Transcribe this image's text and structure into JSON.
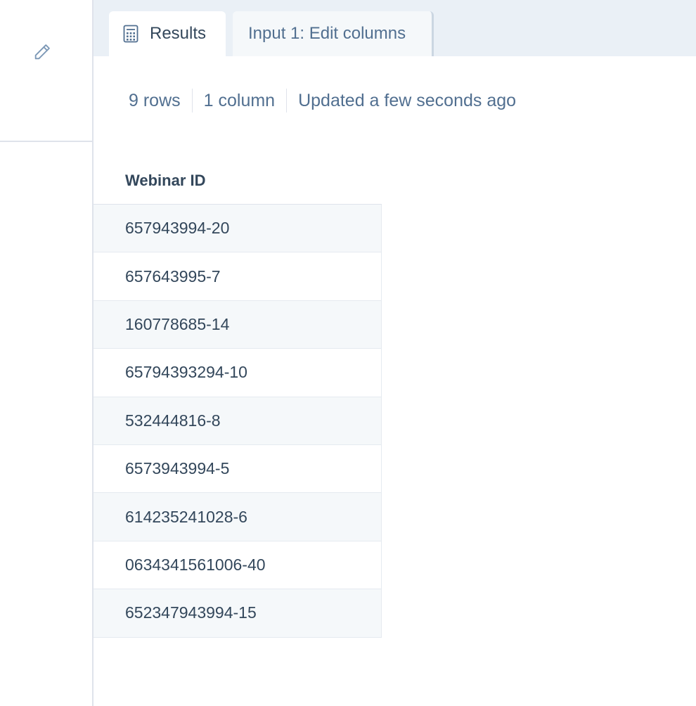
{
  "sidebar": {
    "edit_icon": "pencil-icon"
  },
  "tabs": [
    {
      "label": "Results",
      "icon": "calculator-icon",
      "active": true
    },
    {
      "label": "Input 1: Edit columns",
      "active": false
    }
  ],
  "meta": {
    "rows": "9 rows",
    "columns": "1 column",
    "updated": "Updated a few seconds ago"
  },
  "table": {
    "header": "Webinar ID",
    "rows": [
      "657943994-20",
      "657643995-7",
      "160778685-14",
      "65794393294-10",
      "532444816-8",
      "6573943994-5",
      "614235241028-6",
      "0634341561006-40",
      "652347943994-15"
    ]
  },
  "colors": {
    "text": "#33475b",
    "muted": "#516f90",
    "tabbar_bg": "#eaf0f6",
    "row_alt": "#f5f8fa",
    "border": "#dfe3eb"
  }
}
